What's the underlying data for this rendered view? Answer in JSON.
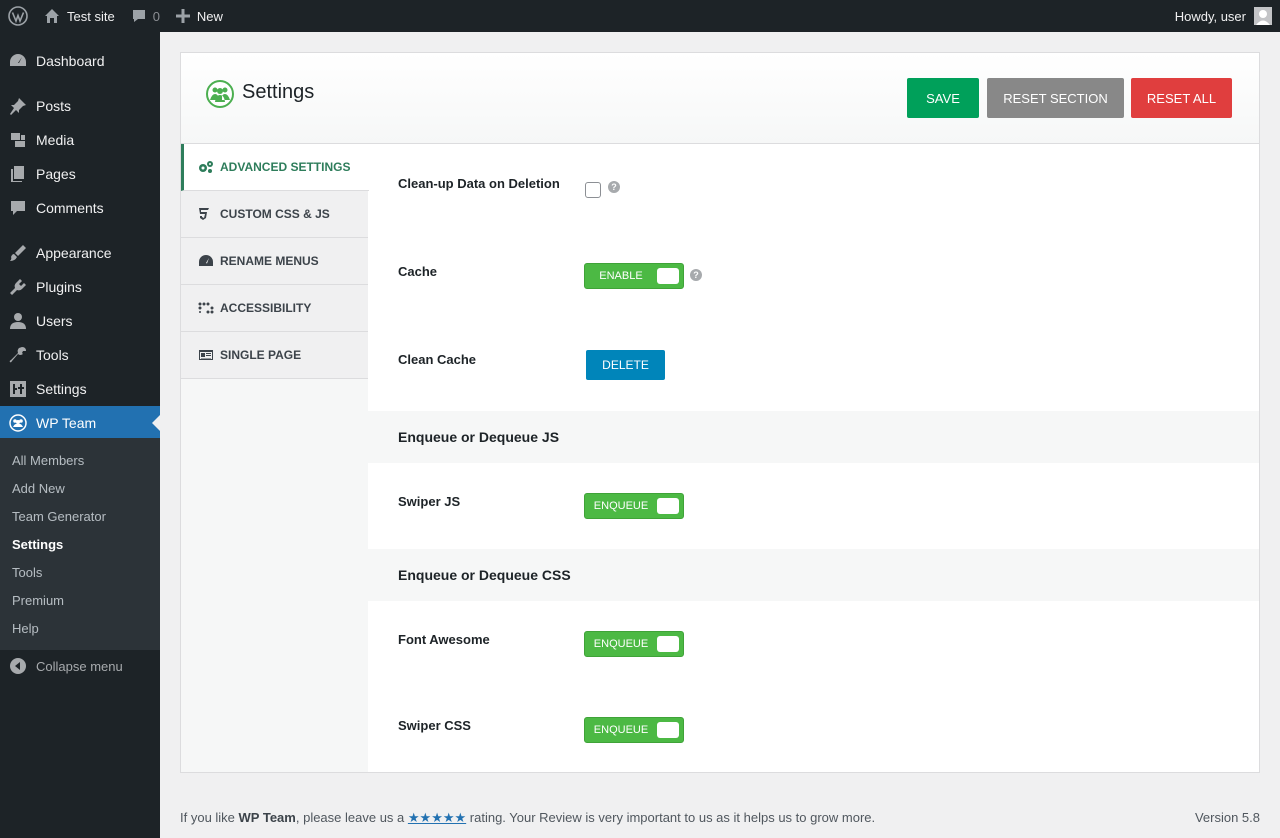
{
  "adminbar": {
    "site_name": "Test site",
    "comments_count": "0",
    "new_label": "New",
    "howdy": "Howdy, user"
  },
  "sidebar": {
    "items": [
      {
        "label": "Dashboard",
        "icon": "dashboard-icon"
      },
      {
        "label": "Posts",
        "icon": "pin-icon"
      },
      {
        "label": "Media",
        "icon": "media-icon"
      },
      {
        "label": "Pages",
        "icon": "pages-icon"
      },
      {
        "label": "Comments",
        "icon": "comment-icon"
      },
      {
        "label": "Appearance",
        "icon": "brush-icon"
      },
      {
        "label": "Plugins",
        "icon": "plugin-icon"
      },
      {
        "label": "Users",
        "icon": "user-icon"
      },
      {
        "label": "Tools",
        "icon": "wrench-icon"
      },
      {
        "label": "Settings",
        "icon": "settings-icon"
      },
      {
        "label": "WP Team",
        "icon": "team-icon"
      }
    ],
    "submenu": [
      "All Members",
      "Add New",
      "Team Generator",
      "Settings",
      "Tools",
      "Premium",
      "Help"
    ],
    "collapse_label": "Collapse menu"
  },
  "panel": {
    "title": "Settings",
    "save_label": "SAVE",
    "reset_section_label": "RESET SECTION",
    "reset_all_label": "RESET ALL"
  },
  "tabs": [
    {
      "label": "ADVANCED SETTINGS",
      "icon": "gears-icon"
    },
    {
      "label": "CUSTOM CSS & JS",
      "icon": "css3-icon"
    },
    {
      "label": "RENAME MENUS",
      "icon": "gauge-icon"
    },
    {
      "label": "ACCESSIBILITY",
      "icon": "braille-icon"
    },
    {
      "label": "SINGLE PAGE",
      "icon": "id-card-icon"
    }
  ],
  "fields": {
    "cleanup_label": "Clean-up Data on Deletion",
    "cache_label": "Cache",
    "cache_toggle": "ENABLE",
    "clean_cache_label": "Clean Cache",
    "delete_label": "DELETE",
    "js_section": "Enqueue or Dequeue JS",
    "swiper_js_label": "Swiper JS",
    "css_section": "Enqueue or Dequeue CSS",
    "font_awesome_label": "Font Awesome",
    "swiper_css_label": "Swiper CSS",
    "enqueue_label": "ENQUEUE",
    "help_glyph": "?"
  },
  "footer": {
    "text_before": "If you like ",
    "plugin_name": "WP Team",
    "text_middle": ", please leave us a ",
    "stars": "★★★★★",
    "text_after": " rating. Your Review is very important to us as it helps us to grow more.",
    "version": "Version 5.8"
  },
  "colors": {
    "accent": "#2271b1",
    "save": "#00a05a",
    "reset_section": "#888888",
    "reset_all": "#e03e3e",
    "toggle_on": "#4cb944",
    "delete": "#0085ba"
  }
}
